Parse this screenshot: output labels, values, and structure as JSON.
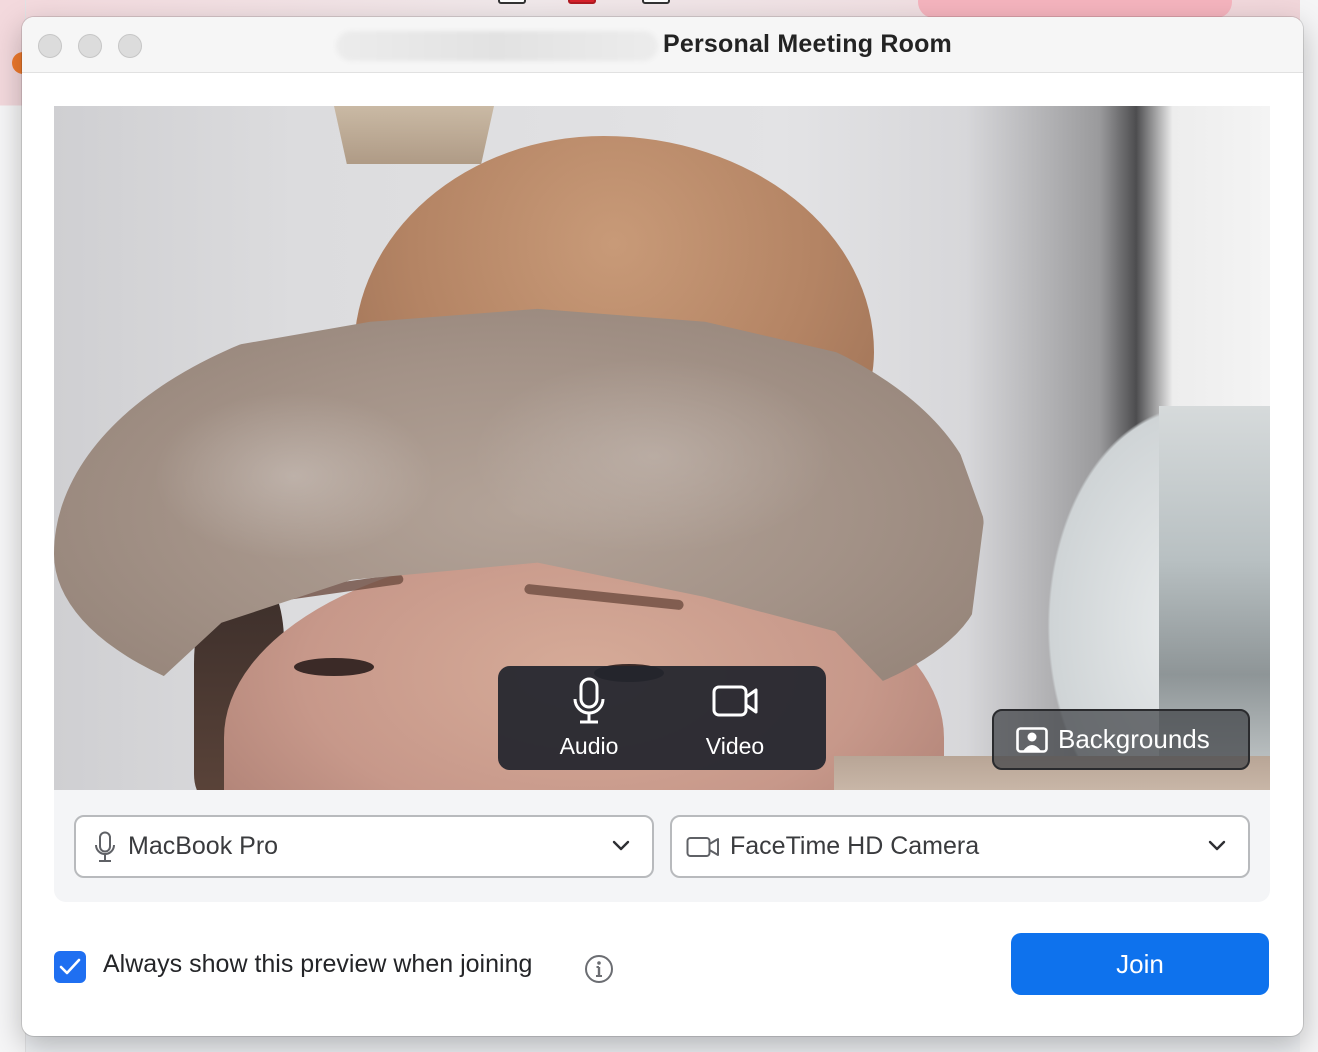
{
  "window": {
    "title": "Personal Meeting Room"
  },
  "preview": {
    "audio_label": "Audio",
    "video_label": "Video",
    "backgrounds_label": "Backgrounds"
  },
  "devices": {
    "microphone": "MacBook Pro",
    "camera": "FaceTime HD Camera"
  },
  "footer": {
    "checkbox_checked": true,
    "checkbox_label": "Always show this preview when joining",
    "join_label": "Join"
  },
  "colors": {
    "accent": "#0e72ed",
    "checkbox": "#1f6ff1",
    "overlay": "#22252d"
  },
  "icons": [
    "microphone-icon",
    "video-camera-icon",
    "backgrounds-icon",
    "chevron-down-icon",
    "checkmark-icon",
    "info-icon"
  ]
}
